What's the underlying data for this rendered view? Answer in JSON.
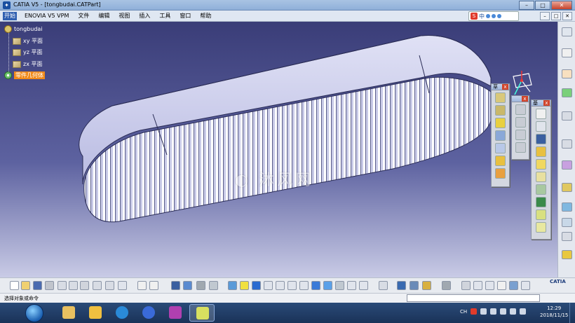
{
  "window": {
    "title": "CATIA V5 - [tongbudai.CATPart]",
    "controls": {
      "minimize": "–",
      "maximize": "□",
      "close": "✕"
    },
    "inner_controls": [
      "–",
      "□",
      "✕"
    ]
  },
  "menubar": {
    "items": [
      "开始",
      "ENOVIA V5 VPM",
      "文件",
      "编辑",
      "视图",
      "插入",
      "工具",
      "窗口",
      "帮助"
    ]
  },
  "ime": {
    "label": "中"
  },
  "tree": {
    "root": "tongbudai",
    "planes": [
      "xy 平面",
      "yz 平面",
      "zx 平面"
    ],
    "body": "零件几何体"
  },
  "toolbars": {
    "floating_1_title": "草",
    "floating_3_title": "基"
  },
  "status": {
    "message": "选择对象或命令"
  },
  "taskbar": {
    "clock_time": "12:29",
    "clock_date": "2018/11/15",
    "tray_lang": "CH"
  },
  "branding": {
    "catia": "CATIA"
  },
  "axis_label": "y",
  "colors": {
    "viewport_top": "#3a3d78",
    "viewport_bottom": "#c9cbe6",
    "belt": "#c8c9ea",
    "selected": "#f08a1a"
  }
}
